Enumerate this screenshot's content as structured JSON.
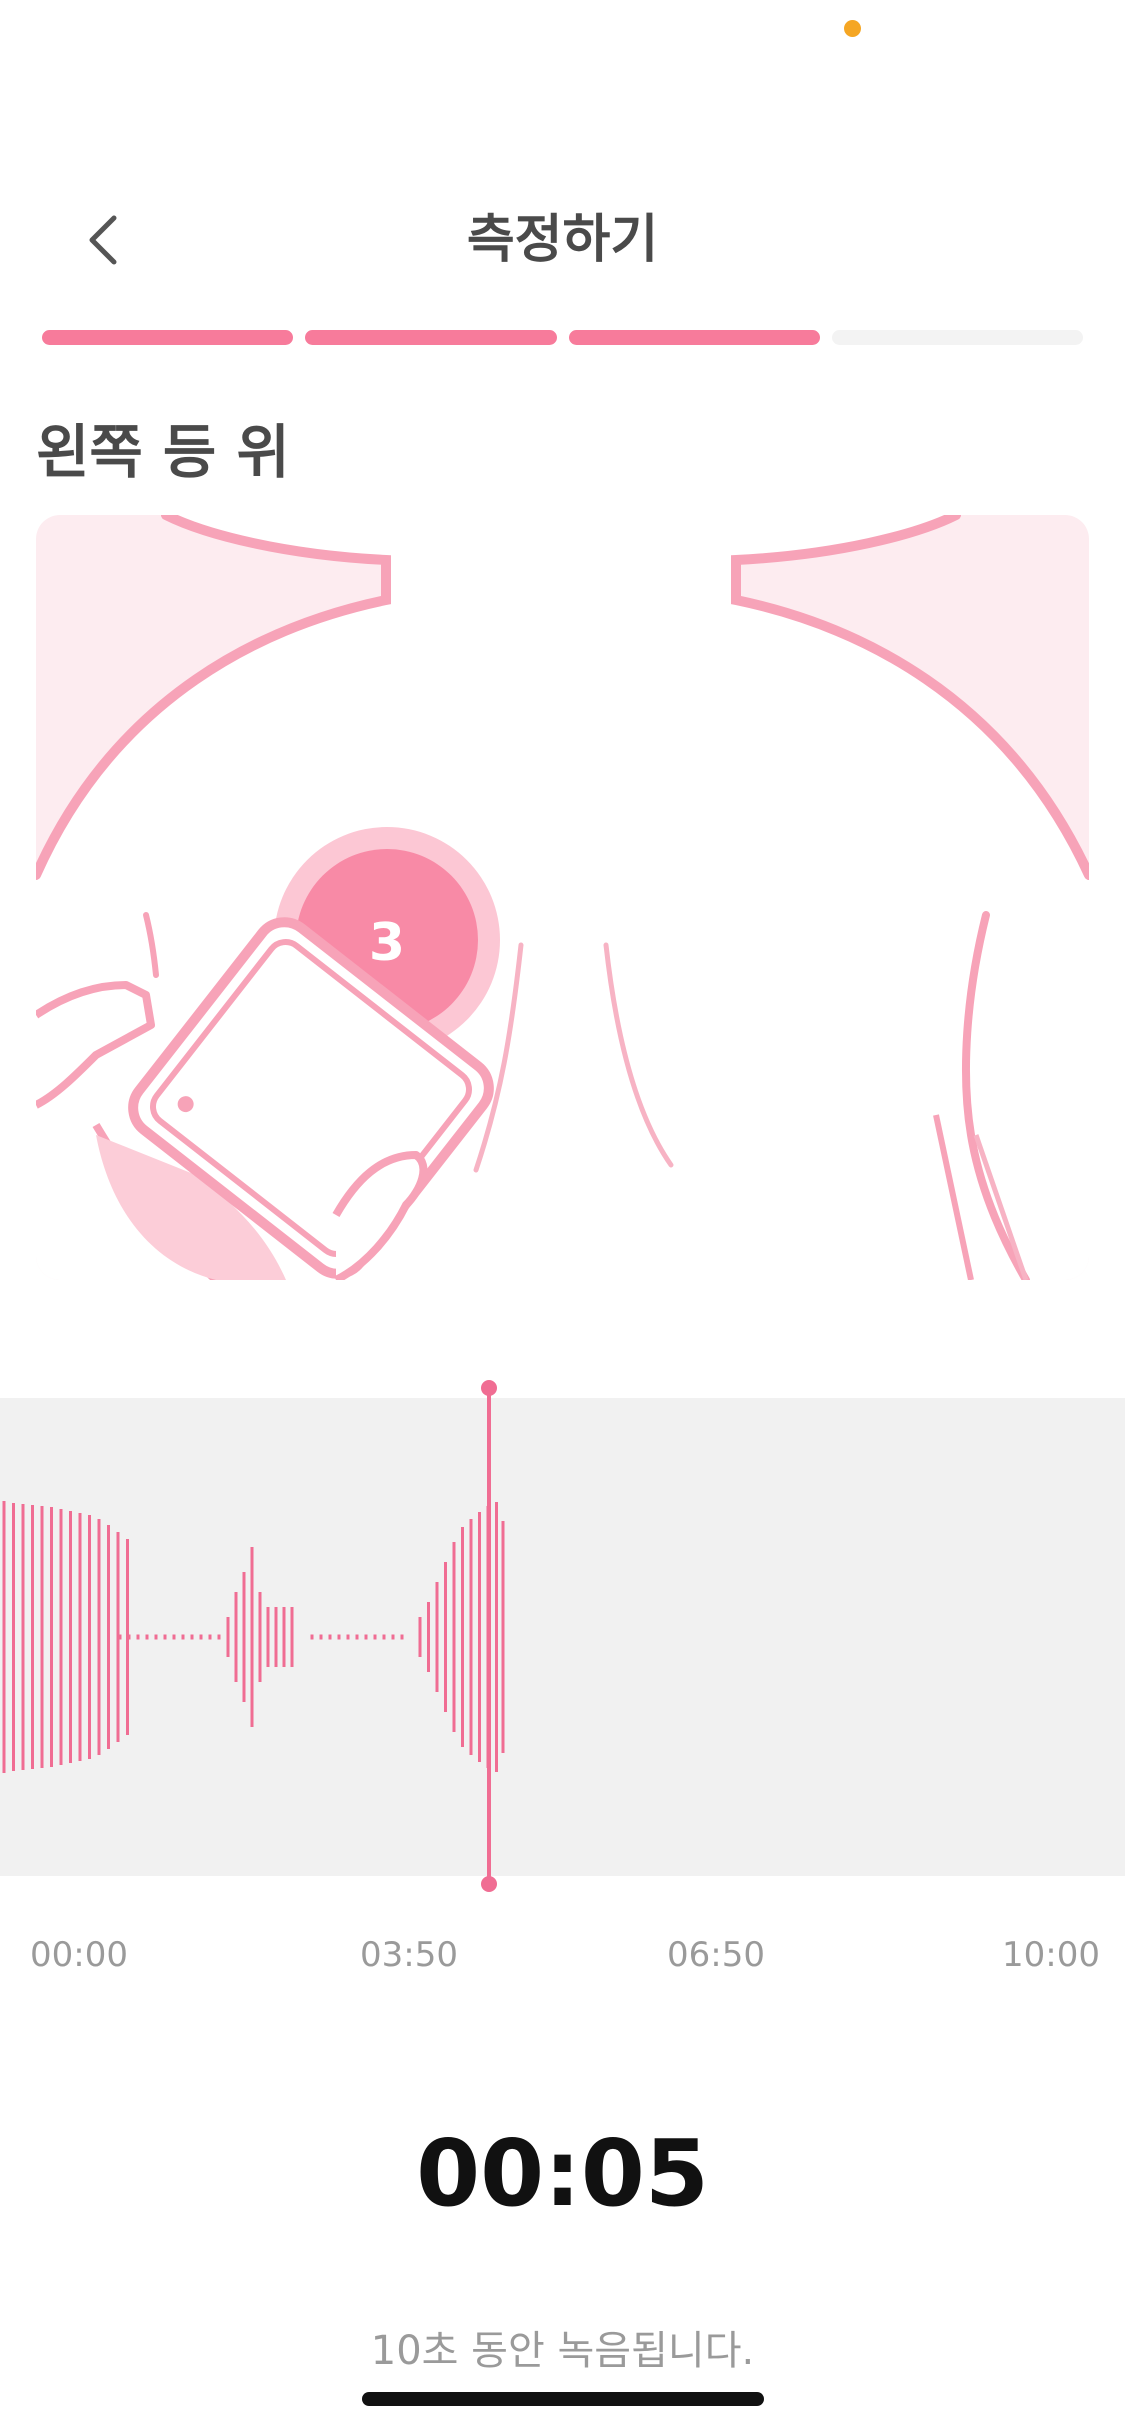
{
  "header": {
    "title": "측정하기",
    "back_icon": "chevron-left-icon"
  },
  "progress": {
    "total_steps": 4,
    "completed_steps": 3
  },
  "section": {
    "title": "왼쪽 등 위"
  },
  "illustration": {
    "step_badge": "3"
  },
  "waveform": {
    "time_labels": [
      "00:00",
      "03:50",
      "06:50",
      "10:00"
    ]
  },
  "recording": {
    "elapsed": "00:05",
    "hint": "10초 동안 녹음됩니다."
  },
  "colors": {
    "accent": "#f77b9b",
    "status_dot": "#f5a623"
  }
}
